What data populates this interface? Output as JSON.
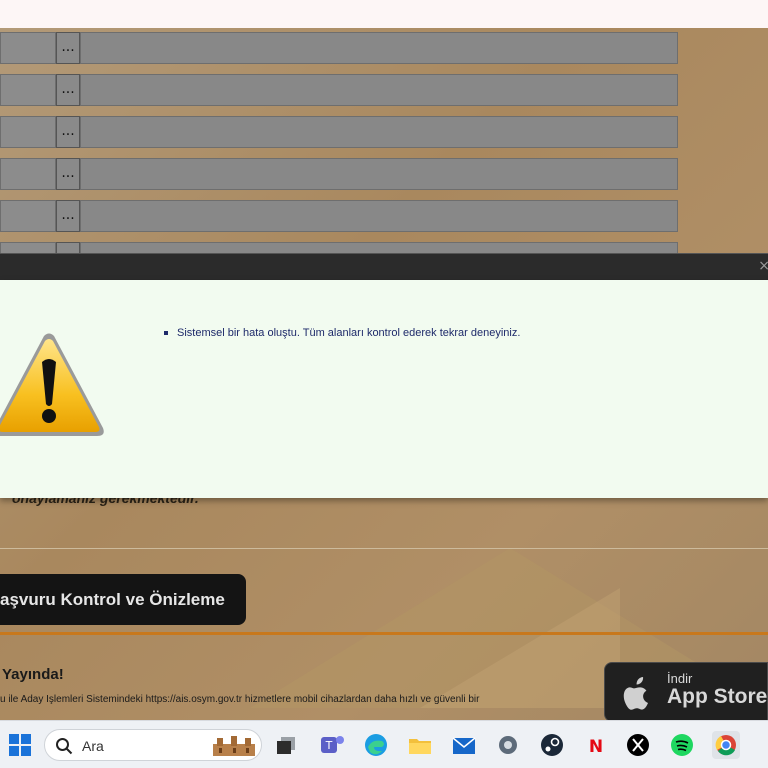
{
  "page": {
    "row_button_label": "...",
    "partial_text": "onaylamanız gerekmektedir.",
    "kontrol_button": "aşvuru Kontrol ve Önizleme",
    "yayinda_title": "Yayında!",
    "description": "u ile Aday İşlemleri Sistemindeki https://ais.osym.gov.tr hizmetlere mobil cihazlardan daha hızlı ve güvenli bir",
    "appstore": {
      "small": "İndir",
      "large": "App Store"
    }
  },
  "modal": {
    "close_glyph": "×",
    "errors": [
      "Sistemsel bir hata oluştu. Tüm alanları kontrol ederek tekrar deneyiniz."
    ]
  },
  "taskbar": {
    "search_placeholder": "Ara",
    "icons": [
      "windows-start",
      "search",
      "taskview",
      "teams",
      "edge",
      "file-explorer",
      "mail",
      "settings",
      "steam",
      "netflix",
      "x",
      "spotify",
      "chrome"
    ]
  },
  "colors": {
    "accent_orange": "#c8781c",
    "modal_bg": "#f2fbf0",
    "error_text": "#1e2a6a"
  }
}
